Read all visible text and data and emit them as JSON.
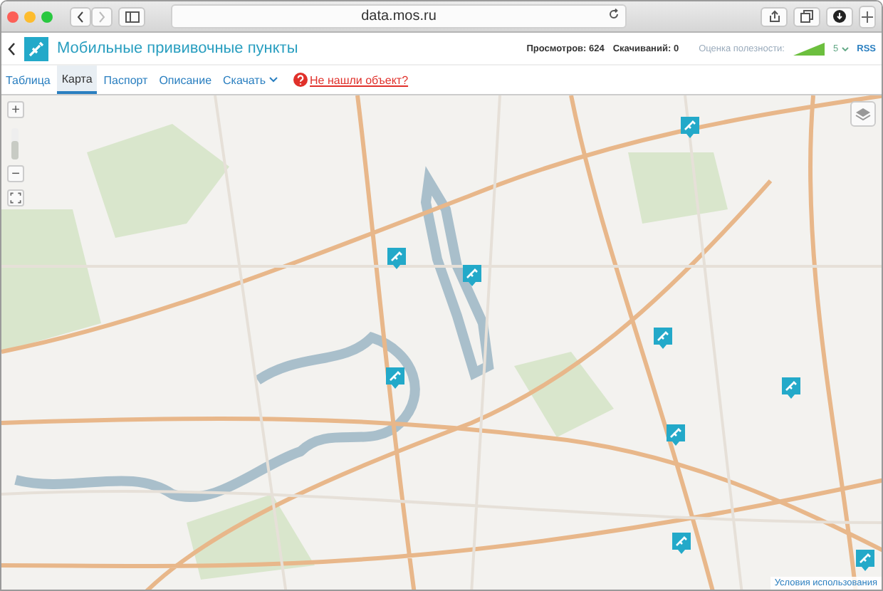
{
  "browser": {
    "address": "data.mos.ru"
  },
  "header": {
    "title": "Мобильные прививочные пункты",
    "views": "Просмотров: 624",
    "downloads": "Скачиваний: 0",
    "rating_label": "Оценка полезности:",
    "rating_value": "5",
    "rss": "RSS"
  },
  "tabs": [
    {
      "label": "Таблица",
      "selected": false,
      "kind": "plain"
    },
    {
      "label": "Карта",
      "selected": true,
      "kind": "plain"
    },
    {
      "label": "Паспорт",
      "selected": false,
      "kind": "plain"
    },
    {
      "label": "Описание",
      "selected": false,
      "kind": "plain"
    },
    {
      "label": "Скачать",
      "selected": false,
      "kind": "dropdown"
    }
  ],
  "report_link": "Не нашли объект?",
  "map": {
    "zoom_in": "+",
    "zoom_out": "−",
    "zoom_slider": {
      "level": 0.6
    },
    "terms": "Условия использования"
  }
}
